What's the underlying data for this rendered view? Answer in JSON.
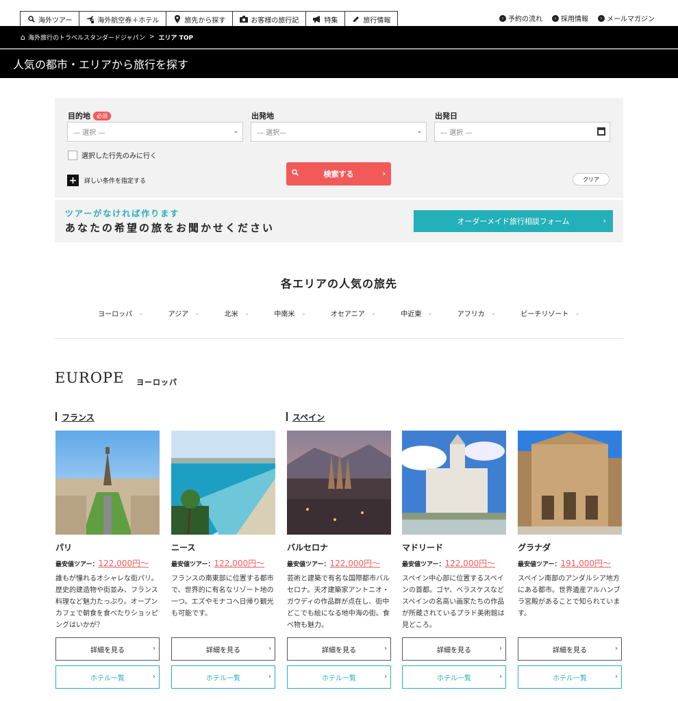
{
  "nav": {
    "tabs": [
      {
        "icon": "search-icon",
        "label": "海外ツアー"
      },
      {
        "icon": "plane-hotel-icon",
        "label": "海外航空券＋ホテル"
      },
      {
        "icon": "pin-icon",
        "label": "旅先から探す"
      },
      {
        "icon": "camera-icon",
        "label": "お客様の旅行記"
      },
      {
        "icon": "megaphone-icon",
        "label": "特集"
      },
      {
        "icon": "pencil-icon",
        "label": "旅行情報"
      }
    ],
    "utility": [
      "予約の流れ",
      "採用情報",
      "メールマガジン"
    ]
  },
  "breadcrumb": {
    "home": "海外旅行のトラベルスタンダードジャパン",
    "separator": ">",
    "current": "エリア TOP"
  },
  "page_title": "人気の都市・エリアから旅行を探す",
  "search": {
    "destination_label": "目的地",
    "required_badge": "必須",
    "destination_placeholder": "— 選択 —",
    "departure_label": "出発地",
    "departure_placeholder": "— 選択—",
    "date_label": "出発日",
    "date_placeholder": "— 選択 —",
    "only_selected": "選択した行先のみに行く",
    "more_conditions": "詳しい条件を指定する",
    "search_button": "検索する",
    "clear_button": "クリア"
  },
  "banner": {
    "sub": "ツアーがなければ作ります",
    "main": "あなたの希望の旅をお聞かせください",
    "cta": "オーダーメイド旅行相談フォーム"
  },
  "areas": {
    "title": "各エリアの人気の旅先",
    "tabs": [
      "ヨーロッパ",
      "アジア",
      "北米",
      "中南米",
      "オセアニア",
      "中近東",
      "アフリカ",
      "ビーチリゾート"
    ]
  },
  "region": {
    "en": "EUROPE",
    "jp": "ヨーロッパ"
  },
  "countries": [
    "フランス",
    "スペイン"
  ],
  "cities": [
    {
      "name": "パリ",
      "price_label": "最安値ツアー：",
      "price": "122,000円～",
      "desc": "誰もが憧れるオシャレな街パリ。歴史的建造物や街並み、フランス料理など魅力たっぷり。オープンカフェで朝食を食べたりショッピングはいかが？",
      "detail": "詳細を見る",
      "hotel": "ホテル一覧"
    },
    {
      "name": "ニース",
      "price_label": "最安値ツアー：",
      "price": "122,000円～",
      "desc": "フランスの南東部に位置する都市で、世界的に有名なリゾート地の一つ。エズやモナコへ日帰り観光も可能です。",
      "detail": "詳細を見る",
      "hotel": "ホテル一覧"
    },
    {
      "name": "バルセロナ",
      "price_label": "最安値ツアー：",
      "price": "122,000円～",
      "desc": "芸術と建築で有名な国際都市バルセロナ。天才建築家アントニオ・ガウディの作品群が点在し、街中どこでも絵になる地中海の街。食べ物も魅力。",
      "detail": "詳細を見る",
      "hotel": "ホテル一覧"
    },
    {
      "name": "マドリード",
      "price_label": "最安値ツアー：",
      "price": "122,000円～",
      "desc": "スペイン中心部に位置するスペインの首都。ゴヤ、ベラスケスなどスペインの名高い画家たちの作品が所蔵されているプラド美術館は見どころ。",
      "detail": "詳細を見る",
      "hotel": "ホテル一覧"
    },
    {
      "name": "グラナダ",
      "price_label": "最安値ツアー：",
      "price": "191,000円～",
      "desc": "スペイン南部のアンダルシア地方にある都市。世界遺産アルハンブラ宮殿があることで知られています。",
      "detail": "詳細を見る",
      "hotel": "ホテル一覧"
    }
  ],
  "colors": {
    "accent_red": "#f25a5a",
    "accent_teal": "#23b0b9",
    "dark": "#000000"
  }
}
